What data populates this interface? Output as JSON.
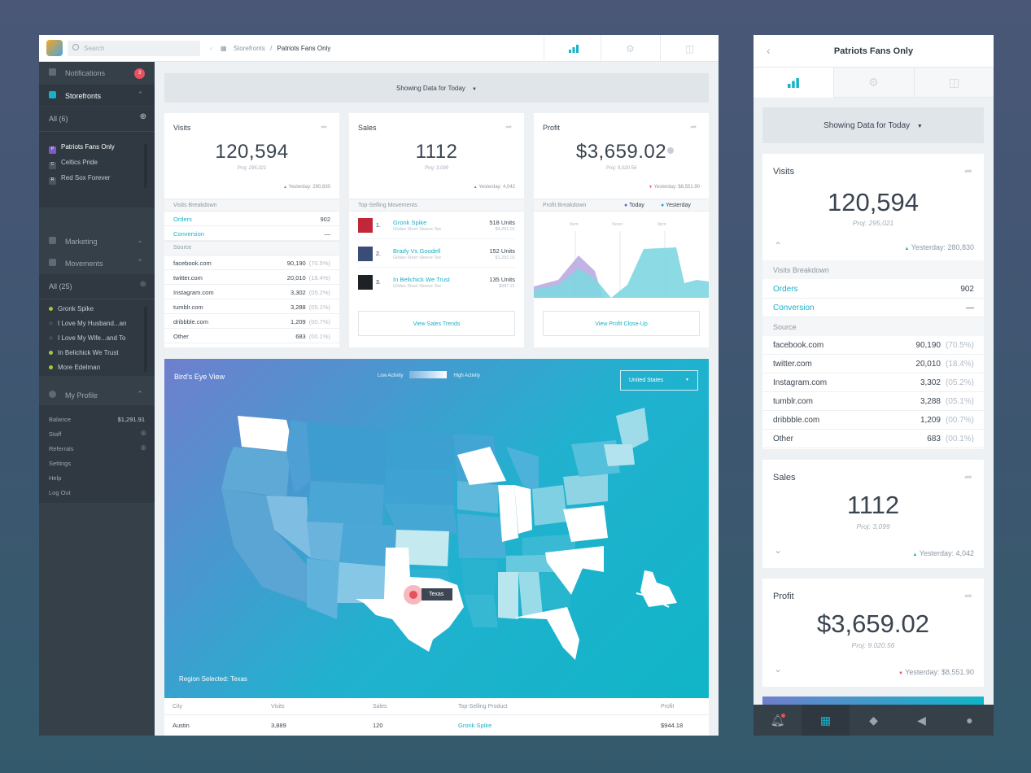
{
  "desktop": {
    "search_placeholder": "Search",
    "breadcrumb": {
      "parent": "Storefronts",
      "separator": "/",
      "current": "Patriots Fans Only"
    },
    "sidebar": {
      "notifications": {
        "label": "Notifications",
        "badge": "3"
      },
      "storefronts": {
        "label": "Storefronts",
        "all": "All (6)",
        "items": [
          "Patriots Fans Only",
          "Celtics Pride",
          "Red Sox Forever"
        ],
        "initials": [
          "P",
          "C",
          "R"
        ]
      },
      "marketing": "Marketing",
      "movements": {
        "label": "Movements",
        "all": "All (25)",
        "items": [
          "Gronk Spike",
          "I Love My Husband...an",
          "I Love My Wife...and To",
          "In Belichick We Trust",
          "More Edelman"
        ]
      },
      "profile": {
        "label": "My Profile",
        "balance_label": "Balance",
        "balance": "$1,291.91",
        "links": [
          "Staff",
          "Referrals",
          "Settings",
          "Help",
          "Log Out"
        ]
      }
    },
    "showing": "Showing Data for Today",
    "visits": {
      "title": "Visits",
      "value": "120,594",
      "proj": "Proj: 295,021",
      "yesterday": "Yesterday: 280,830",
      "breakdown": "Visits Breakdown",
      "orders_label": "Orders",
      "orders": "902",
      "conversion_label": "Conversion",
      "conversion": "—",
      "source": "Source",
      "sources": [
        {
          "name": "facebook.com",
          "value": "90,190",
          "pct": "(70.5%)"
        },
        {
          "name": "twitter.com",
          "value": "20,010",
          "pct": "(18.4%)"
        },
        {
          "name": "Instagram.com",
          "value": "3,302",
          "pct": "(05.2%)"
        },
        {
          "name": "tumblr.com",
          "value": "3,288",
          "pct": "(05.1%)"
        },
        {
          "name": "dribbble.com",
          "value": "1,209",
          "pct": "(00.7%)"
        },
        {
          "name": "Other",
          "value": "683",
          "pct": "(00.1%)"
        }
      ]
    },
    "sales": {
      "title": "Sales",
      "value": "1112",
      "proj": "Proj: 3,099",
      "yesterday": "Yesterday: 4,042",
      "top": "Top-Selling Movements",
      "products": [
        {
          "rank": "1.",
          "name": "Gronk Spike",
          "desc": "Gildan Short Sleeve Tee",
          "units": "518 Units",
          "price": "$4,291.01"
        },
        {
          "rank": "2.",
          "name": "Brady Vs Goodell",
          "desc": "Gildan Short Sleeve Tee",
          "units": "152 Units",
          "price": "$1,291.01"
        },
        {
          "rank": "3.",
          "name": "In Belichick We Trust",
          "desc": "Gildan Short Sleeve Tee",
          "units": "135 Units",
          "price": "$987.21"
        }
      ],
      "button": "View Sales Trends"
    },
    "profit": {
      "title": "Profit",
      "value": "$3,659.02",
      "proj": "Proj: 9,020.56",
      "yesterday": "Yesterday: $8,551.90",
      "breakdown": "Profit Breakdown",
      "today": "Today",
      "yest": "Yesterday",
      "times": [
        "9am",
        "Noon",
        "9pm"
      ],
      "button": "View Profit Close-Up"
    },
    "map": {
      "title": "Bird's Eye View",
      "low": "Low Activity",
      "high": "High Activity",
      "country": "United States",
      "tooltip": "Texas",
      "region": "Region Selected: Texas"
    },
    "table": {
      "headers": [
        "City",
        "Visits",
        "Sales",
        "Top-Selling Product",
        "Profit"
      ],
      "row": [
        "Austin",
        "3,889",
        "120",
        "Gronk Spike",
        "$944.18"
      ]
    }
  },
  "mobile": {
    "title": "Patriots Fans Only",
    "showing": "Showing Data for Today",
    "visits": {
      "title": "Visits",
      "value": "120,594",
      "proj": "Proj: 295,021",
      "yesterday": "Yesterday: 280,830",
      "breakdown": "Visits Breakdown",
      "orders_label": "Orders",
      "orders": "902",
      "conversion_label": "Conversion",
      "conversion": "—",
      "source": "Source"
    },
    "sales": {
      "title": "Sales",
      "value": "1112",
      "proj": "Proj: 3,099",
      "yesterday": "Yesterday: 4,042"
    },
    "profit": {
      "title": "Profit",
      "value": "$3,659.02",
      "proj": "Proj: 9,020.56",
      "yesterday": "Yesterday: $8,551.90"
    }
  },
  "colors": {
    "accent": "#17b2c8",
    "sidebar": "#364049",
    "badge": "#e5515f",
    "green": "#9ccc3c"
  }
}
